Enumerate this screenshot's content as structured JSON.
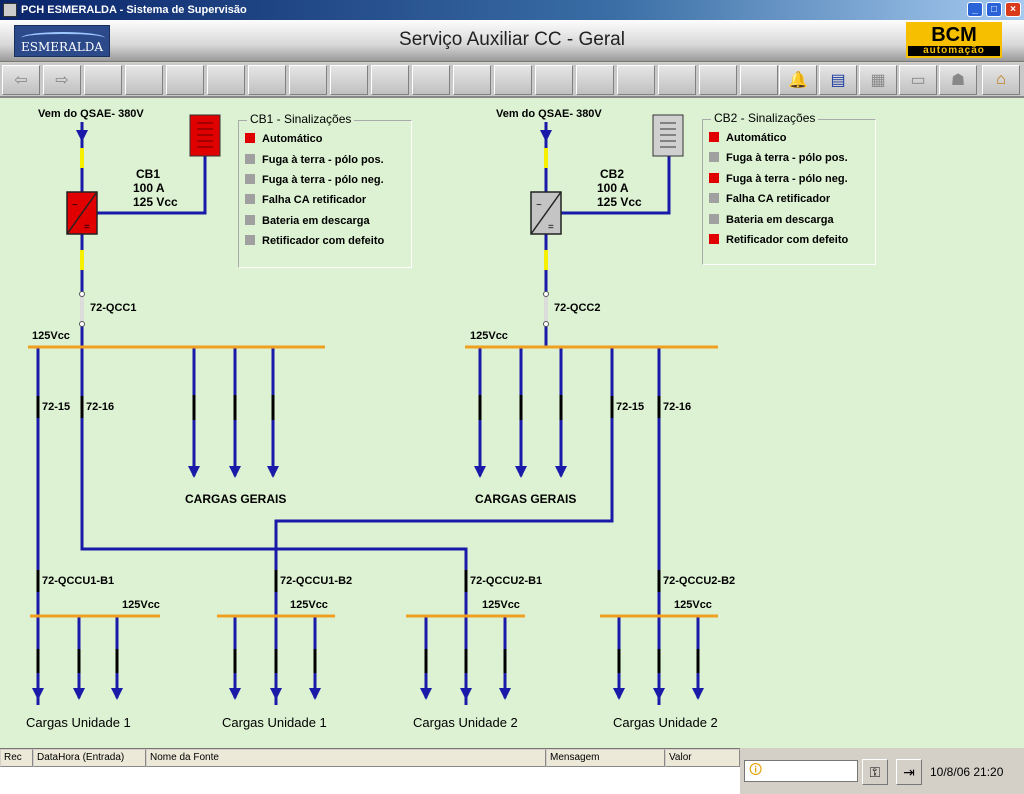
{
  "window": {
    "title": "PCH ESMERALDA - Sistema de Supervisão"
  },
  "header": {
    "title": "Serviço Auxiliar CC - Geral",
    "logo_left": "ESMERALDA",
    "logo_right": "BCM",
    "logo_right_sub": "automação"
  },
  "colors": {
    "line": "#1a1aa8",
    "bus": "#f0a020",
    "fuse": "#f6f000",
    "alarm": "#e00000",
    "normal": "#a0a0a0",
    "canvas": "#dcf2d2"
  },
  "diagram": {
    "cb1": {
      "source": "Vem do QSAE- 380V",
      "charger_label": "CB1",
      "current": "100 A",
      "voltage": "125 Vcc",
      "breaker": "72-QCC1",
      "bus": "125Vcc",
      "feeders": [
        "72-15",
        "72-16"
      ],
      "loads": "CARGAS GERAIS",
      "legend_title": "CB1 - Sinalizações",
      "signals": [
        {
          "label": "Automático",
          "state": "alarm"
        },
        {
          "label": "Fuga à terra - pólo pos.",
          "state": "normal"
        },
        {
          "label": "Fuga à terra - pólo neg.",
          "state": "normal"
        },
        {
          "label": "Falha CA retificador",
          "state": "normal"
        },
        {
          "label": "Bateria em descarga",
          "state": "normal"
        },
        {
          "label": "Retificador com defeito",
          "state": "normal"
        }
      ]
    },
    "cb2": {
      "source": "Vem do QSAE- 380V",
      "charger_label": "CB2",
      "current": "100 A",
      "voltage": "125 Vcc",
      "breaker": "72-QCC2",
      "bus": "125Vcc",
      "feeders": [
        "72-15",
        "72-16"
      ],
      "loads": "CARGAS GERAIS",
      "legend_title": "CB2 - Sinalizações",
      "signals": [
        {
          "label": "Automático",
          "state": "alarm"
        },
        {
          "label": "Fuga à terra - pólo pos.",
          "state": "normal"
        },
        {
          "label": "Fuga à terra - pólo neg.",
          "state": "alarm"
        },
        {
          "label": "Falha CA retificador",
          "state": "normal"
        },
        {
          "label": "Bateria em descarga",
          "state": "normal"
        },
        {
          "label": "Retificador com defeito",
          "state": "alarm"
        }
      ]
    },
    "units": [
      {
        "breaker": "72-QCCU1-B1",
        "bus": "125Vcc",
        "loads": "Cargas Unidade 1"
      },
      {
        "breaker": "72-QCCU1-B2",
        "bus": "125Vcc",
        "loads": "Cargas Unidade 1"
      },
      {
        "breaker": "72-QCCU2-B1",
        "bus": "125Vcc",
        "loads": "Cargas Unidade 2"
      },
      {
        "breaker": "72-QCCU2-B2",
        "bus": "125Vcc",
        "loads": "Cargas Unidade 2"
      }
    ]
  },
  "events": {
    "columns": [
      "Rec",
      "DataHora (Entrada)",
      "Nome da Fonte",
      "Mensagem",
      "Valor"
    ]
  },
  "status": {
    "datetime": "10/8/06 21:20"
  },
  "toolbar": {
    "icons": [
      "back-arrow-icon",
      "forward-arrow-icon",
      "bell-icon",
      "list-icon",
      "grid-icon",
      "window-icon",
      "users-icon",
      "home-icon"
    ]
  }
}
